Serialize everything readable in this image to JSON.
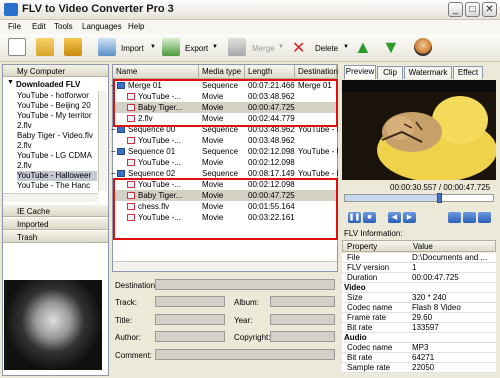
{
  "window": {
    "title": "FLV to Video Converter Pro 3"
  },
  "menu": [
    "File",
    "Edit",
    "Tools",
    "Languages",
    "Help"
  ],
  "toolbar": {
    "import": "Import",
    "export": "Export",
    "merge": "Merge",
    "delete": "Delete"
  },
  "left": {
    "my_computer": "My Computer",
    "downloaded": "Downloaded FLV",
    "files": [
      "YouTube - hotforwor",
      "YouTube - Beijing 20",
      "YouTube - My territor",
      "2.flv",
      "Baby Tiger - Video.flv",
      "2.flv",
      "YouTube - LG CDMA",
      "2.flv",
      "YouTube - Halloweer",
      "YouTube - The Hanc"
    ],
    "ie_cache": "IE Cache",
    "imported": "Imported",
    "trash": "Trash"
  },
  "columns": [
    "Name",
    "Media type",
    "Length",
    "Destination"
  ],
  "rows": [
    {
      "name": "Merge 01",
      "type": "Sequence",
      "length": "00:07:21.466",
      "dest": "Merge 01",
      "level": 0
    },
    {
      "name": "YouTube -...",
      "type": "Movie",
      "length": "00:03:48.962",
      "dest": "",
      "level": 1
    },
    {
      "name": "Baby Tiger...",
      "type": "Movie",
      "length": "00:00:47.725",
      "dest": "",
      "level": 1
    },
    {
      "name": "2.flv",
      "type": "Movie",
      "length": "00:02:44.779",
      "dest": "",
      "level": 1
    },
    {
      "name": "Sequence 00",
      "type": "Sequence",
      "length": "00:03:48.962",
      "dest": "YouTube - M",
      "level": 0
    },
    {
      "name": "YouTube -...",
      "type": "Movie",
      "length": "00:03:48.962",
      "dest": "",
      "level": 1
    },
    {
      "name": "Sequence 01",
      "type": "Sequence",
      "length": "00:02:12.098",
      "dest": "YouTube - H",
      "level": 0
    },
    {
      "name": "YouTube -...",
      "type": "Movie",
      "length": "00:02:12.098",
      "dest": "",
      "level": 1
    },
    {
      "name": "Sequence 02",
      "type": "Sequence",
      "length": "00:08:17.149",
      "dest": "YouTube - H",
      "level": 0
    },
    {
      "name": "YouTube -...",
      "type": "Movie",
      "length": "00:02:12.098",
      "dest": "",
      "level": 1
    },
    {
      "name": "Baby Tiger...",
      "type": "Movie",
      "length": "00:00:47.725",
      "dest": "",
      "level": 1
    },
    {
      "name": "chess.flv",
      "type": "Movie",
      "length": "00:01:55.164",
      "dest": "",
      "level": 1
    },
    {
      "name": "YouTube -...",
      "type": "Movie",
      "length": "00:03:22.161",
      "dest": "",
      "level": 1
    }
  ],
  "details": {
    "destination": "Destination:",
    "track": "Track:",
    "album": "Album:",
    "title": "Title:",
    "year": "Year:",
    "author": "Author:",
    "copyright": "Copyright:",
    "comment": "Comment:"
  },
  "preview": {
    "tabs": [
      "Preview",
      "Clip",
      "Watermark",
      "Effect"
    ],
    "time": "00:00:30.557 / 00:00:47.725",
    "seek_fraction": 0.64,
    "flv_info": "FLV Information:",
    "prop_headers": [
      "Property",
      "Value"
    ],
    "props": [
      {
        "p": "File",
        "v": "D:\\Documents and ..."
      },
      {
        "p": "FLV version",
        "v": "1"
      },
      {
        "p": "Duration",
        "v": "00:00:47.725"
      },
      {
        "p": "Video",
        "v": "",
        "group": true
      },
      {
        "p": "Size",
        "v": "320 * 240"
      },
      {
        "p": "Codec name",
        "v": "Flash 8 Video"
      },
      {
        "p": "Frame rate",
        "v": "29.60"
      },
      {
        "p": "Bit rate",
        "v": "133597"
      },
      {
        "p": "Audio",
        "v": "",
        "group": true
      },
      {
        "p": "Codec name",
        "v": "MP3"
      },
      {
        "p": "Bit rate",
        "v": "64271"
      },
      {
        "p": "Sample rate",
        "v": "22050"
      }
    ]
  }
}
